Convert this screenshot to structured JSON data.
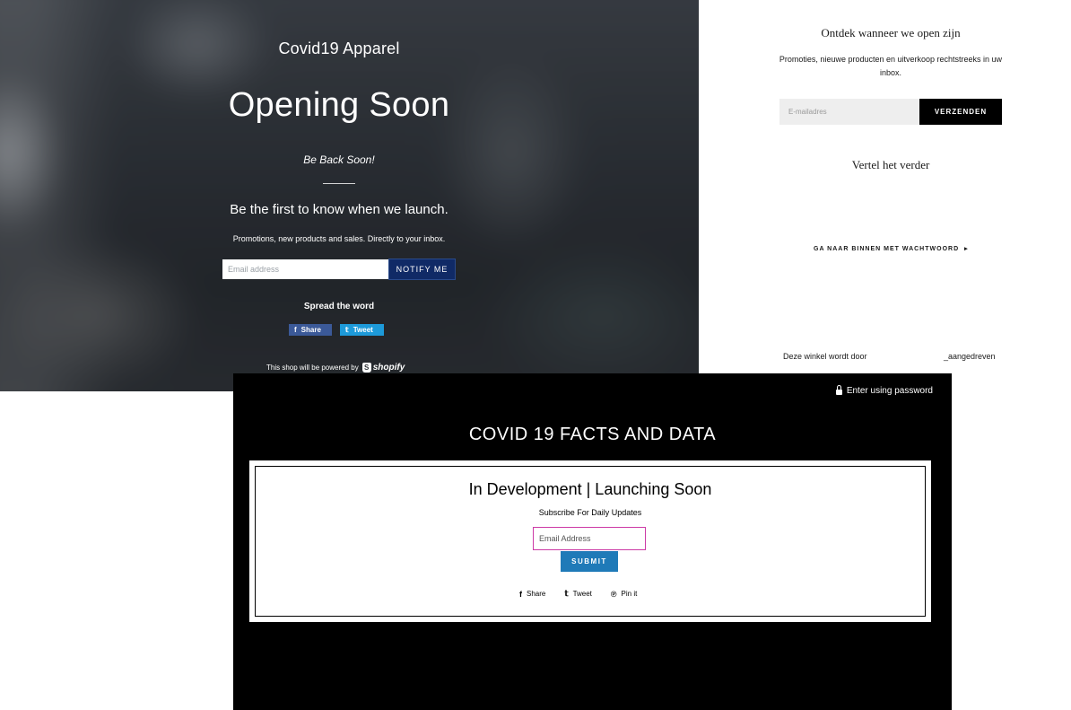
{
  "hero": {
    "shop_name": "Covid19 Apparel",
    "title": "Opening Soon",
    "subtitle": "Be Back Soon!",
    "lead": "Be the first to know when we launch.",
    "small_text": "Promotions, new products and sales. Directly to your inbox.",
    "email_placeholder": "Email address",
    "notify_label": "NOTIFY ME",
    "spread_label": "Spread the word",
    "share_label": "Share",
    "tweet_label": "Tweet",
    "powered_text": "This shop will be powered by",
    "shopify_word": "shopify"
  },
  "nl": {
    "heading": "Ontdek wanneer we open zijn",
    "text": "Promoties, nieuwe producten en uitverkoop rechtstreeks in uw inbox.",
    "email_placeholder": "E-mailadres",
    "submit_label": "VERZENDEN",
    "share_heading": "Vertel het verder",
    "password_link": "GA NAAR BINNEN MET WACHTWOORD",
    "powered_prefix": "Deze winkel wordt door",
    "powered_suffix": "_aangedreven"
  },
  "covid": {
    "password_link": "Enter using password",
    "title": "COVID 19 FACTS AND DATA",
    "heading": "In Development | Launching Soon",
    "subheading": "Subscribe For Daily Updates",
    "email_placeholder": "Email Address",
    "submit_label": "SUBMIT",
    "share": [
      {
        "icon": "facebook-icon",
        "glyph": "f",
        "label": "Share"
      },
      {
        "icon": "twitter-icon",
        "glyph": "𝕥",
        "label": "Tweet"
      },
      {
        "icon": "pinterest-icon",
        "glyph": "℗",
        "label": "Pin it"
      }
    ]
  },
  "colors": {
    "notify_button": "#102a66",
    "facebook": "#3b5998",
    "twitter": "#1d9ad9",
    "covid_submit": "#1f7ab8",
    "covid_input_border": "#cc3aa6"
  }
}
